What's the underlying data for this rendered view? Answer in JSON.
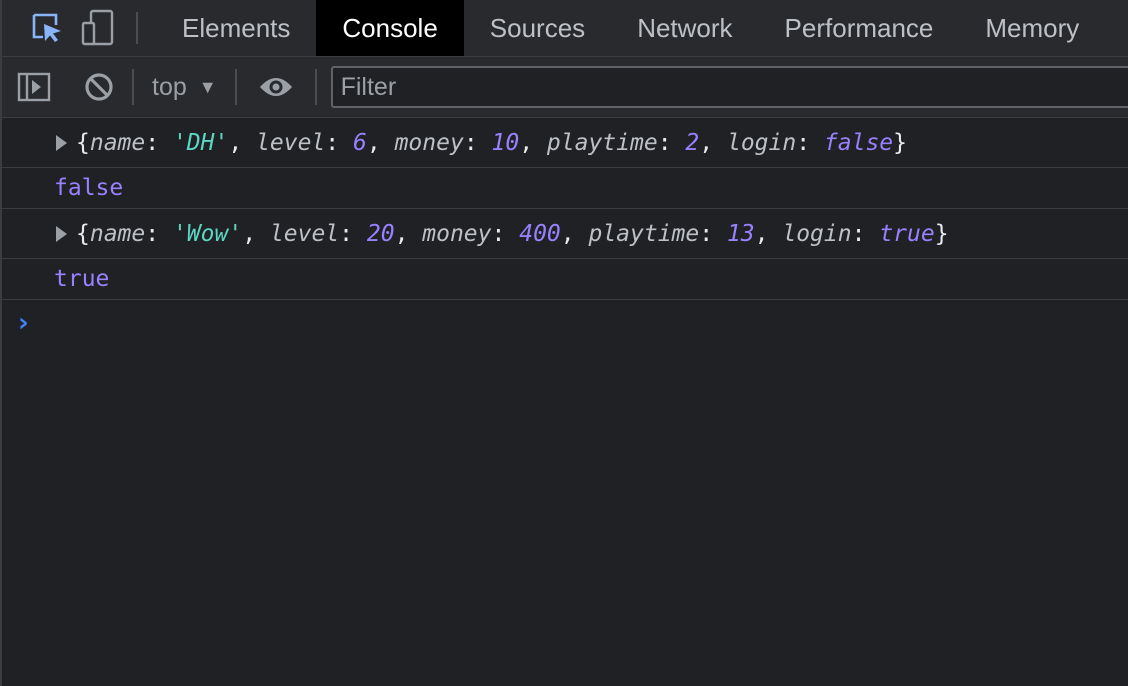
{
  "toolbar_icons": {
    "inspect": "inspect-element-icon",
    "device": "device-toolbar-icon"
  },
  "tabs": [
    {
      "label": "Elements",
      "active": false
    },
    {
      "label": "Console",
      "active": true
    },
    {
      "label": "Sources",
      "active": false
    },
    {
      "label": "Network",
      "active": false
    },
    {
      "label": "Performance",
      "active": false
    },
    {
      "label": "Memory",
      "active": false
    }
  ],
  "console_toolbar": {
    "sidebar_icon": "show-sidebar-icon",
    "clear_icon": "clear-console-icon",
    "context": "top",
    "context_arrow": "▼",
    "eye_icon": "live-expression-icon",
    "filter_placeholder": "Filter"
  },
  "messages": {
    "m1": {
      "open": "{",
      "f1": {
        "key": "name",
        "val": "'DH'"
      },
      "f2": {
        "key": "level",
        "val": "6"
      },
      "f3": {
        "key": "money",
        "val": "10"
      },
      "f4": {
        "key": "playtime",
        "val": "2"
      },
      "f5": {
        "key": "login",
        "val": "false"
      },
      "close": "}"
    },
    "m2": {
      "text": "false"
    },
    "m3": {
      "open": "{",
      "f1": {
        "key": "name",
        "val": "'Wow'"
      },
      "f2": {
        "key": "level",
        "val": "20"
      },
      "f3": {
        "key": "money",
        "val": "400"
      },
      "f4": {
        "key": "playtime",
        "val": "13"
      },
      "f5": {
        "key": "login",
        "val": "true"
      },
      "close": "}"
    },
    "m4": {
      "text": "true"
    }
  },
  "prompt": {
    "symbol": "›"
  },
  "colors": {
    "background": "#202124",
    "string": "#5cd5c2",
    "number": "#9980ff",
    "prompt": "#3e82f7",
    "active_tab": "#000000"
  }
}
